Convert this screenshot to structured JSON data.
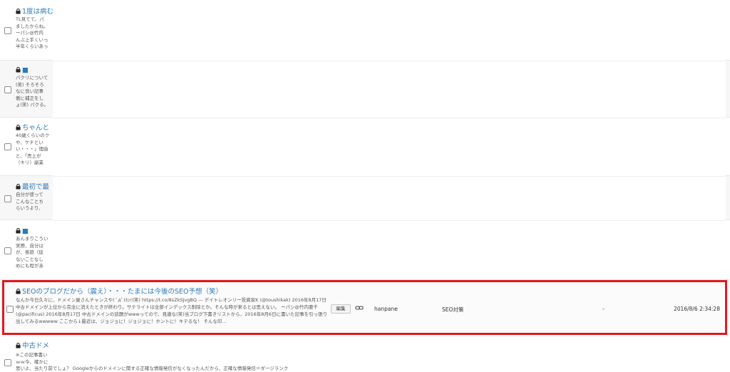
{
  "posts": [
    {
      "title": "1度は病む",
      "excerpt": [
        "TL見てて、パ",
        "ましたからね。",
        "ーパシ@竹内",
        "んぶ上手くいっ",
        "半年くらいあっ"
      ]
    },
    {
      "title": "■",
      "excerpt": [
        "パクリについて",
        "(笑) そろそろ",
        "なに良い記事",
        "側に補正をし",
        "ょ(笑) パクる。"
      ]
    },
    {
      "title": "ちゃんと",
      "excerpt": [
        "40歳くらいのク",
        "や、ケチとい",
        "い・・・」理由",
        "と、「売上が",
        "（キリ）副業"
      ]
    },
    {
      "title": "最初で最",
      "excerpt": [
        "自分が使って",
        "こんなことち",
        "らいうより、"
      ]
    },
    {
      "title": "■",
      "excerpt": [
        "あんまりこうい",
        "実際、自分は",
        "が、羨旅（従",
        "ないことなし",
        "めにも程があ"
      ]
    }
  ],
  "highlighted": {
    "title": "SEOのブログだから（震え）・・・たまには今後のSEO予想（笑）",
    "excerpt": "なんか今日久々に、ドメイン屋さんチャンスや( ﾟдﾟ)ﾎｼｲ(笑) https://t.co/8sZkSJvgBQ — デイトレオンリー投資家K (@toushikak) 2016年8月17日 中古ドメインが上位から完全に消えたときが終わり。サテライトは全部インデックス削除とか。そんな時が来るとは思えない。 ーパシ@竹内亜千 (@pacificus) 2016年8月17日 中古ドメインの話題がwwwってので、見違な(笑)当ブログ下書きリストから、2016年8月6日に書いた記事を引っ張り出してみるwwwww ここから↓最近は、ジョジョに！ジョジョに！ホントに！キテるな！ そんな印...",
    "edit_label": "編集",
    "author": "hanpane",
    "category": "SEO対策",
    "tags": "-",
    "date": "2016/8/6 2:34:28"
  },
  "bottom_post": {
    "title": "中古ドメ",
    "excerpt": [
      "※この記事書い",
      "ｗｗ今、確かに",
      "思いよ、当たり前でしょ？ Googleからのドメインに関する正確な情報発信がなくなったんだから、正確な情報発信＝ダージランク"
    ]
  },
  "colors": {
    "link": "#2b7bbf",
    "highlight_border": "#e3171e"
  }
}
